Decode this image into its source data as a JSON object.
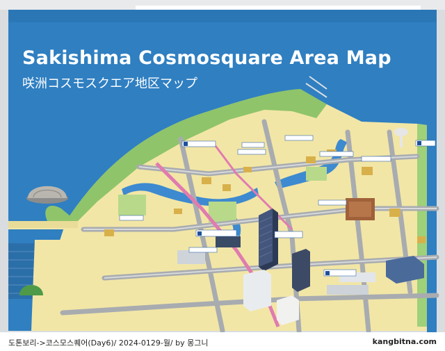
{
  "map": {
    "title_en": "Sakishima Cosmosquare Area Map",
    "title_ja": "咲洲コスモスクエア地区マップ"
  },
  "caption": {
    "left": "도톤보리->코스모스퀘어(Day6)/ 2024-0129-월/  by 몽그니",
    "right": "kangbitna.com"
  },
  "colors": {
    "sea": "#2f7fc1",
    "land": "#f2e6a6",
    "park": "#8fc46a",
    "road": "#9fa3a6",
    "label_box": "#ffffff"
  }
}
